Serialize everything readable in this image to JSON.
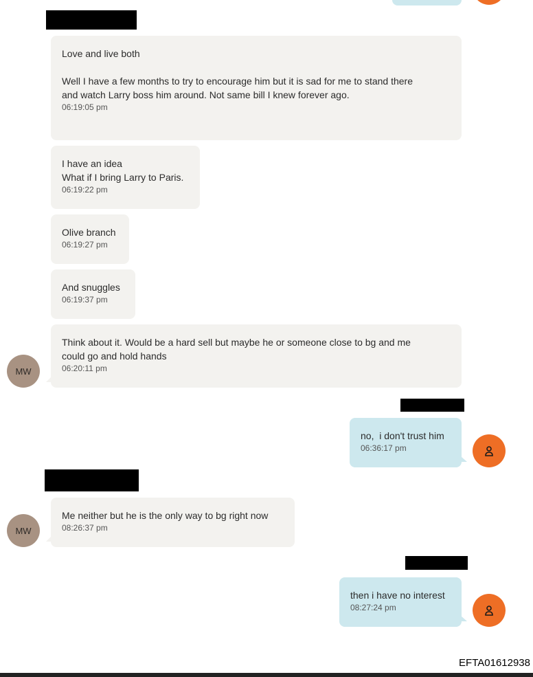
{
  "colors": {
    "incoming_bubble": "#f3f2ef",
    "outgoing_bubble": "#cde8ee",
    "mw_avatar": "#a89282",
    "me_avatar": "#ee6e25",
    "redaction": "#000000"
  },
  "avatars": {
    "mw_initials": "MW",
    "me_icon": "person-icon"
  },
  "messages": [
    {
      "direction": "in",
      "text": "Love and live both\n\nWell I have a few months to try to encourage him but it is sad for me to stand there\nand watch Larry boss him around. Not same bill I knew forever ago.\n",
      "time": "06:19:05 pm"
    },
    {
      "direction": "in",
      "text": "I have an idea\nWhat if I bring Larry to Paris.",
      "time": "06:19:22 pm"
    },
    {
      "direction": "in",
      "text": "Olive branch",
      "time": "06:19:27 pm"
    },
    {
      "direction": "in",
      "text": "And snuggles",
      "time": "06:19:37 pm"
    },
    {
      "direction": "in",
      "text": "Think about it. Would be a hard sell but maybe he or someone close to bg and me\ncould go and hold hands",
      "time": "06:20:11 pm"
    },
    {
      "direction": "out",
      "text": "no,  i don't trust him",
      "time": "06:36:17 pm"
    },
    {
      "direction": "in",
      "text": "Me neither but he is the only way to bg right now",
      "time": "08:26:37 pm"
    },
    {
      "direction": "out",
      "text": "then i have no interest",
      "time": "08:27:24 pm"
    }
  ],
  "footer": {
    "doc_id": "EFTA01612938"
  }
}
